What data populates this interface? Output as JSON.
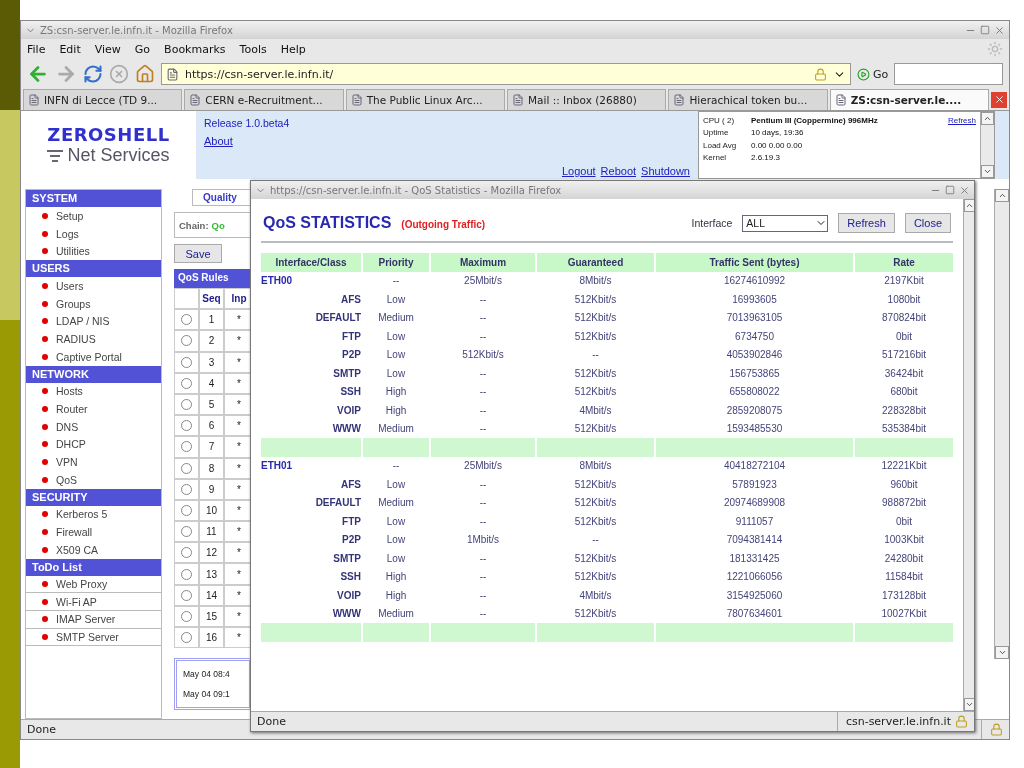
{
  "browser": {
    "title": "ZS:csn-server.le.infn.it - Mozilla Firefox",
    "menu": [
      "File",
      "Edit",
      "View",
      "Go",
      "Bookmarks",
      "Tools",
      "Help"
    ],
    "url": "https://csn-server.le.infn.it/",
    "go": "Go",
    "tabs": [
      {
        "label": "INFN di Lecce (TD 9...",
        "selected": false
      },
      {
        "label": "CERN e-Recruitment...",
        "selected": false
      },
      {
        "label": "The Public Linux Arc...",
        "selected": false
      },
      {
        "label": "Mail :: Inbox (26880)",
        "selected": false
      },
      {
        "label": "Hierachical token bu...",
        "selected": false
      },
      {
        "label": "ZS:csn-server.le....",
        "selected": true
      }
    ],
    "status": "Done"
  },
  "header": {
    "logo": "ZEROSHELL",
    "logo_sub": "Net Services",
    "release": "Release 1.0.beta4",
    "about": "About",
    "actions": [
      "Logout",
      "Reboot",
      "Shutdown"
    ],
    "sysinfo": [
      {
        "label": "CPU ( 2)",
        "value": "Pentium III (Coppermine) 996MHz",
        "bold": true
      },
      {
        "label": "Uptime",
        "value": "10 days, 19:36",
        "bold": false
      },
      {
        "label": "Load Avg",
        "value": "0.00 0.00 0.00",
        "bold": false
      },
      {
        "label": "Kernel",
        "value": "2.6.19.3",
        "bold": false
      }
    ],
    "refresh": "Refresh"
  },
  "sidebar": [
    {
      "title": "SYSTEM",
      "boxed": false,
      "items": [
        "Setup",
        "Logs",
        "Utilities"
      ]
    },
    {
      "title": "USERS",
      "boxed": false,
      "items": [
        "Users",
        "Groups",
        "LDAP / NIS",
        "RADIUS",
        "Captive Portal"
      ]
    },
    {
      "title": "NETWORK",
      "boxed": false,
      "items": [
        "Hosts",
        "Router",
        "DNS",
        "DHCP",
        "VPN",
        "QoS"
      ]
    },
    {
      "title": "SECURITY",
      "boxed": false,
      "items": [
        "Kerberos 5",
        "Firewall",
        "X509 CA"
      ]
    },
    {
      "title": "ToDo List",
      "boxed": true,
      "items": [
        "Web Proxy",
        "Wi-Fi AP",
        "IMAP Server",
        "SMTP Server"
      ]
    }
  ],
  "main": {
    "tab": "Quality",
    "chain_label": "Chain:",
    "chain_value": "Qo",
    "button": "Save",
    "rules_title": "QoS Rules",
    "columns": [
      "Seq",
      "Inp"
    ],
    "rows": [
      {
        "seq": "1",
        "input": "*",
        "selected": false
      },
      {
        "seq": "2",
        "input": "*",
        "selected": false
      },
      {
        "seq": "3",
        "input": "*",
        "selected": false
      },
      {
        "seq": "4",
        "input": "*",
        "selected": false
      },
      {
        "seq": "5",
        "input": "*",
        "selected": false
      },
      {
        "seq": "6",
        "input": "*",
        "selected": false
      },
      {
        "seq": "7",
        "input": "*",
        "selected": false
      },
      {
        "seq": "8",
        "input": "*",
        "selected": false
      },
      {
        "seq": "9",
        "input": "*",
        "selected": false
      },
      {
        "seq": "10",
        "input": "*",
        "selected": false
      },
      {
        "seq": "11",
        "input": "*",
        "selected": false
      },
      {
        "seq": "12",
        "input": "*",
        "selected": false
      },
      {
        "seq": "13",
        "input": "*",
        "selected": false
      },
      {
        "seq": "14",
        "input": "*",
        "selected": false
      },
      {
        "seq": "15",
        "input": "*",
        "selected": false
      },
      {
        "seq": "16",
        "input": "*",
        "selected": false
      }
    ],
    "log": [
      "May 04 08:4",
      "May 04 09:1"
    ]
  },
  "popup": {
    "title": "https://csn-server.le.infn.it - QoS Statistics - Mozilla Firefox",
    "heading": "QoS STATISTICS",
    "subheading": "(Outgoing Traffic)",
    "interface_label": "Interface",
    "interface_value": "ALL",
    "buttons": [
      "Refresh",
      "Close"
    ],
    "columns": [
      "Interface/Class",
      "Priority",
      "Maximum",
      "Guaranteed",
      "Traffic Sent (bytes)",
      "Rate"
    ],
    "rows": [
      {
        "kind": "interface",
        "name": "ETH00",
        "priority": "--",
        "maximum": "25Mbit/s",
        "guaranteed": "8Mbit/s",
        "sent": "16274610992",
        "rate": "2197Kbit"
      },
      {
        "kind": "class",
        "name": "AFS",
        "priority": "Low",
        "maximum": "--",
        "guaranteed": "512Kbit/s",
        "sent": "16993605",
        "rate": "1080bit"
      },
      {
        "kind": "class",
        "name": "DEFAULT",
        "priority": "Medium",
        "maximum": "--",
        "guaranteed": "512Kbit/s",
        "sent": "7013963105",
        "rate": "870824bit"
      },
      {
        "kind": "class",
        "name": "FTP",
        "priority": "Low",
        "maximum": "--",
        "guaranteed": "512Kbit/s",
        "sent": "6734750",
        "rate": "0bit"
      },
      {
        "kind": "class",
        "name": "P2P",
        "priority": "Low",
        "maximum": "512Kbit/s",
        "guaranteed": "--",
        "sent": "4053902846",
        "rate": "517216bit"
      },
      {
        "kind": "class",
        "name": "SMTP",
        "priority": "Low",
        "maximum": "--",
        "guaranteed": "512Kbit/s",
        "sent": "156753865",
        "rate": "36424bit"
      },
      {
        "kind": "class",
        "name": "SSH",
        "priority": "High",
        "maximum": "--",
        "guaranteed": "512Kbit/s",
        "sent": "655808022",
        "rate": "680bit"
      },
      {
        "kind": "class",
        "name": "VOIP",
        "priority": "High",
        "maximum": "--",
        "guaranteed": "4Mbit/s",
        "sent": "2859208075",
        "rate": "228328bit"
      },
      {
        "kind": "class",
        "name": "WWW",
        "priority": "Medium",
        "maximum": "--",
        "guaranteed": "512Kbit/s",
        "sent": "1593485530",
        "rate": "535384bit"
      },
      {
        "kind": "separator"
      },
      {
        "kind": "interface",
        "name": "ETH01",
        "priority": "--",
        "maximum": "25Mbit/s",
        "guaranteed": "8Mbit/s",
        "sent": "40418272104",
        "rate": "12221Kbit"
      },
      {
        "kind": "class",
        "name": "AFS",
        "priority": "Low",
        "maximum": "--",
        "guaranteed": "512Kbit/s",
        "sent": "57891923",
        "rate": "960bit"
      },
      {
        "kind": "class",
        "name": "DEFAULT",
        "priority": "Medium",
        "maximum": "--",
        "guaranteed": "512Kbit/s",
        "sent": "20974689908",
        "rate": "988872bit"
      },
      {
        "kind": "class",
        "name": "FTP",
        "priority": "Low",
        "maximum": "--",
        "guaranteed": "512Kbit/s",
        "sent": "9111057",
        "rate": "0bit"
      },
      {
        "kind": "class",
        "name": "P2P",
        "priority": "Low",
        "maximum": "1Mbit/s",
        "guaranteed": "--",
        "sent": "7094381414",
        "rate": "1003Kbit"
      },
      {
        "kind": "class",
        "name": "SMTP",
        "priority": "Low",
        "maximum": "--",
        "guaranteed": "512Kbit/s",
        "sent": "181331425",
        "rate": "24280bit"
      },
      {
        "kind": "class",
        "name": "SSH",
        "priority": "High",
        "maximum": "--",
        "guaranteed": "512Kbit/s",
        "sent": "1221066056",
        "rate": "11584bit"
      },
      {
        "kind": "class",
        "name": "VOIP",
        "priority": "High",
        "maximum": "--",
        "guaranteed": "4Mbit/s",
        "sent": "3154925060",
        "rate": "173128bit"
      },
      {
        "kind": "class",
        "name": "WWW",
        "priority": "Medium",
        "maximum": "--",
        "guaranteed": "512Kbit/s",
        "sent": "7807634601",
        "rate": "10027Kbit"
      },
      {
        "kind": "separator"
      }
    ],
    "status": "Done",
    "host": "csn-server.le.infn.it"
  }
}
